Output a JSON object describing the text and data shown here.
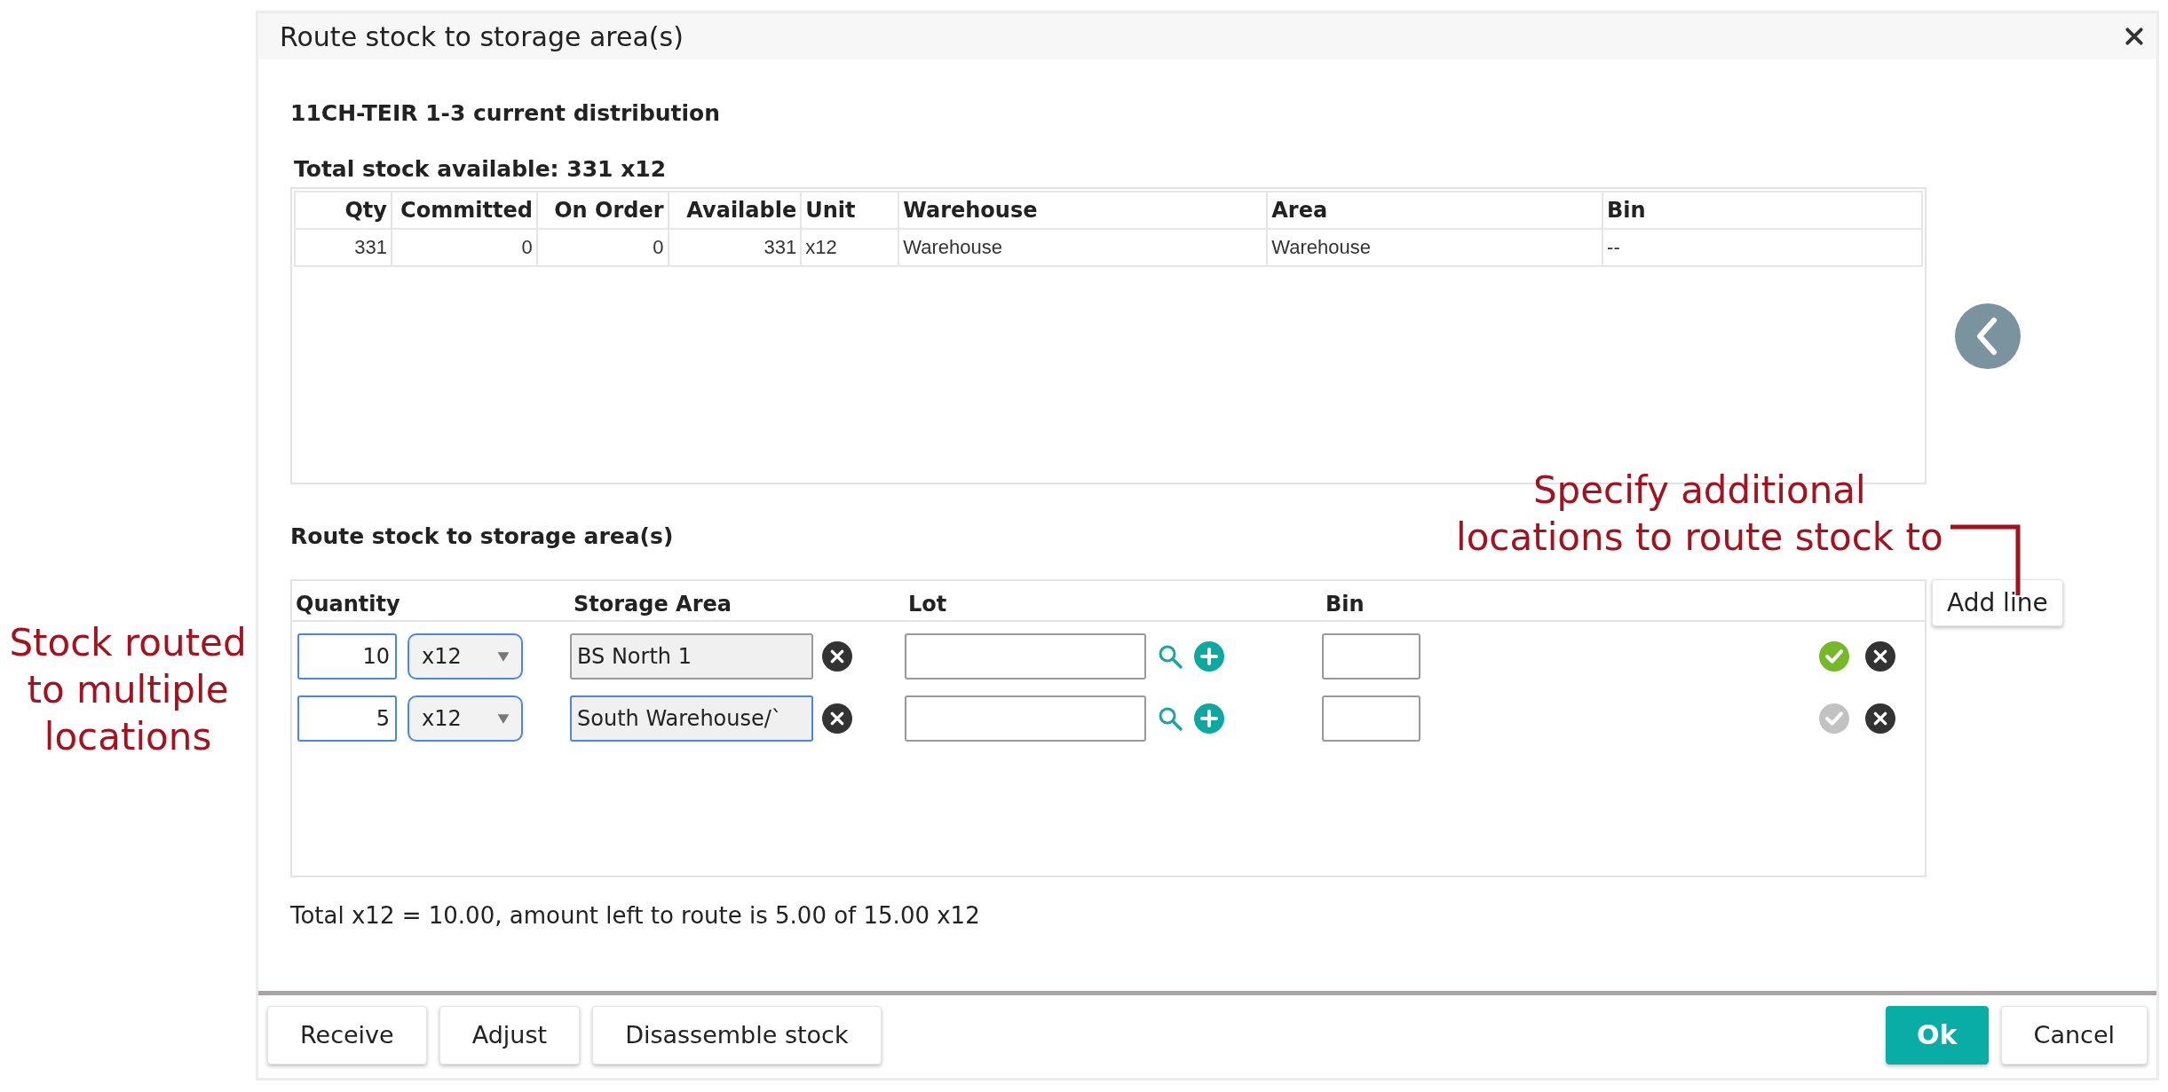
{
  "dialog": {
    "title": "Route stock to storage area(s)"
  },
  "distribution": {
    "heading": "11CH-TEIR 1-3 current distribution",
    "total": "Total stock available: 331 x12",
    "columns": [
      "Qty",
      "Committed",
      "On Order",
      "Available",
      "Unit",
      "Warehouse",
      "Area",
      "Bin"
    ],
    "rows": [
      [
        "331",
        "0",
        "0",
        "331",
        "x12",
        "Warehouse",
        "Warehouse",
        "--"
      ]
    ]
  },
  "routing": {
    "heading": "Route stock to storage area(s)",
    "columns": [
      "Quantity",
      "Storage Area",
      "Lot",
      "Bin"
    ],
    "add_button": "Add line",
    "rows": [
      {
        "quantity": "10",
        "unit": "x12",
        "storage_area": "BS North 1",
        "focused": false,
        "confirmed": true
      },
      {
        "quantity": "5",
        "unit": "x12",
        "storage_area": "South Warehouse/`",
        "focused": true,
        "confirmed": false
      }
    ]
  },
  "summary": "Total x12 = 10.00, amount left to route is 5.00 of 15.00 x12",
  "buttons": [
    {
      "label": "Receive",
      "kind": "plain"
    },
    {
      "label": "Adjust",
      "kind": "plain"
    },
    {
      "label": "Disassemble stock",
      "kind": "plain"
    },
    {
      "label": "Ok",
      "kind": "primary"
    },
    {
      "label": "Cancel",
      "kind": "plain"
    }
  ],
  "annotations": [
    {
      "text": "Stock routed\nto multiple\nlocations",
      "kind": "left"
    },
    {
      "text": "Specify additional\nlocations to route stock to",
      "kind": "right"
    }
  ]
}
